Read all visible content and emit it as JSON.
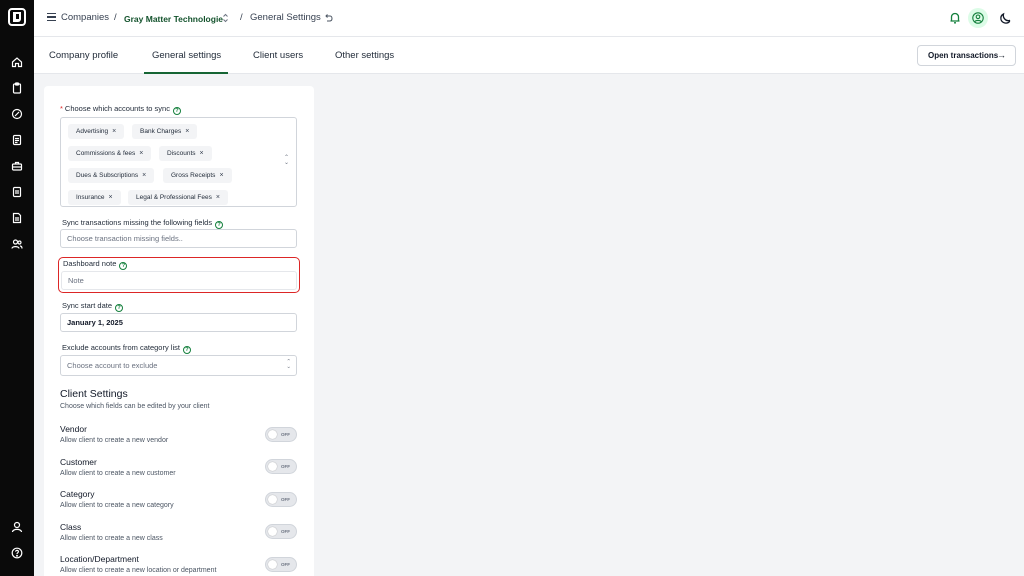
{
  "breadcrumb": {
    "root": "Companies",
    "separator": "/",
    "company": "Gray Matter Technologie",
    "page": "General Settings"
  },
  "tabs": [
    {
      "label": "Company profile"
    },
    {
      "label": "General settings",
      "active": true
    },
    {
      "label": "Client users"
    },
    {
      "label": "Other settings"
    }
  ],
  "actions": {
    "open_transactions": "Open transactions"
  },
  "sync_accounts": {
    "label": "Choose which accounts to sync",
    "required_mark": "*",
    "chips": [
      "Advertising",
      "Bank Charges",
      "Commissions & fees",
      "Discounts",
      "Dues & Subscriptions",
      "Gross Receipts",
      "Insurance",
      "Legal & Professional Fees"
    ]
  },
  "missing_fields": {
    "label": "Sync transactions missing the following fields",
    "placeholder": "Choose transaction missing fields.."
  },
  "dashboard_note": {
    "label": "Dashboard note",
    "placeholder": "Note"
  },
  "sync_start": {
    "label": "Sync start date",
    "value": "January 1, 2025"
  },
  "exclude_accounts": {
    "label": "Exclude accounts from category list",
    "placeholder": "Choose account to exclude"
  },
  "client_settings": {
    "title": "Client Settings",
    "subtitle": "Choose which fields can be edited by your client",
    "toggle_off_label": "OFF",
    "items": [
      {
        "title": "Vendor",
        "desc": "Allow client to create a new vendor",
        "on": false
      },
      {
        "title": "Customer",
        "desc": "Allow client to create a new customer",
        "on": false
      },
      {
        "title": "Category",
        "desc": "Allow client to create a new category",
        "on": false
      },
      {
        "title": "Class",
        "desc": "Allow client to create a new class",
        "on": false
      },
      {
        "title": "Location/Department",
        "desc": "Allow client to create a new location or department",
        "on": false
      }
    ]
  },
  "colors": {
    "accent": "#166534",
    "sidebar": "#0a0a0a",
    "highlight": "#dc2626"
  },
  "icons": {
    "sidebar": [
      "home-icon",
      "clipboard-icon",
      "gauge-icon",
      "document-icon",
      "briefcase-icon",
      "book-icon",
      "file-text-icon",
      "users-icon"
    ],
    "sidebar_bottom": [
      "user-icon",
      "help-icon"
    ],
    "top": [
      "bell-icon",
      "account-icon",
      "moon-icon"
    ]
  }
}
